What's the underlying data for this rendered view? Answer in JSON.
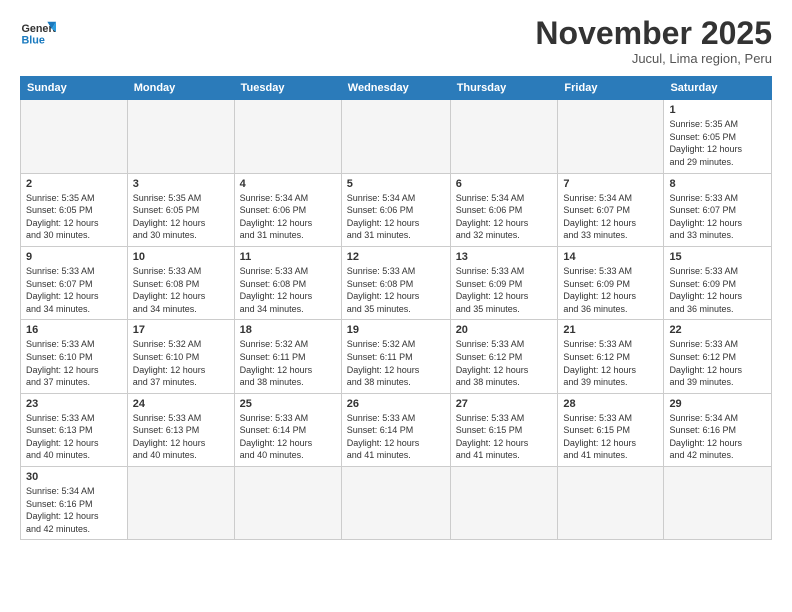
{
  "header": {
    "logo_general": "General",
    "logo_blue": "Blue",
    "month_title": "November 2025",
    "subtitle": "Jucul, Lima region, Peru"
  },
  "days_of_week": [
    "Sunday",
    "Monday",
    "Tuesday",
    "Wednesday",
    "Thursday",
    "Friday",
    "Saturday"
  ],
  "weeks": [
    [
      {
        "day": "",
        "info": ""
      },
      {
        "day": "",
        "info": ""
      },
      {
        "day": "",
        "info": ""
      },
      {
        "day": "",
        "info": ""
      },
      {
        "day": "",
        "info": ""
      },
      {
        "day": "",
        "info": ""
      },
      {
        "day": "1",
        "info": "Sunrise: 5:35 AM\nSunset: 6:05 PM\nDaylight: 12 hours\nand 29 minutes."
      }
    ],
    [
      {
        "day": "2",
        "info": "Sunrise: 5:35 AM\nSunset: 6:05 PM\nDaylight: 12 hours\nand 30 minutes."
      },
      {
        "day": "3",
        "info": "Sunrise: 5:35 AM\nSunset: 6:05 PM\nDaylight: 12 hours\nand 30 minutes."
      },
      {
        "day": "4",
        "info": "Sunrise: 5:34 AM\nSunset: 6:06 PM\nDaylight: 12 hours\nand 31 minutes."
      },
      {
        "day": "5",
        "info": "Sunrise: 5:34 AM\nSunset: 6:06 PM\nDaylight: 12 hours\nand 31 minutes."
      },
      {
        "day": "6",
        "info": "Sunrise: 5:34 AM\nSunset: 6:06 PM\nDaylight: 12 hours\nand 32 minutes."
      },
      {
        "day": "7",
        "info": "Sunrise: 5:34 AM\nSunset: 6:07 PM\nDaylight: 12 hours\nand 33 minutes."
      },
      {
        "day": "8",
        "info": "Sunrise: 5:33 AM\nSunset: 6:07 PM\nDaylight: 12 hours\nand 33 minutes."
      }
    ],
    [
      {
        "day": "9",
        "info": "Sunrise: 5:33 AM\nSunset: 6:07 PM\nDaylight: 12 hours\nand 34 minutes."
      },
      {
        "day": "10",
        "info": "Sunrise: 5:33 AM\nSunset: 6:08 PM\nDaylight: 12 hours\nand 34 minutes."
      },
      {
        "day": "11",
        "info": "Sunrise: 5:33 AM\nSunset: 6:08 PM\nDaylight: 12 hours\nand 34 minutes."
      },
      {
        "day": "12",
        "info": "Sunrise: 5:33 AM\nSunset: 6:08 PM\nDaylight: 12 hours\nand 35 minutes."
      },
      {
        "day": "13",
        "info": "Sunrise: 5:33 AM\nSunset: 6:09 PM\nDaylight: 12 hours\nand 35 minutes."
      },
      {
        "day": "14",
        "info": "Sunrise: 5:33 AM\nSunset: 6:09 PM\nDaylight: 12 hours\nand 36 minutes."
      },
      {
        "day": "15",
        "info": "Sunrise: 5:33 AM\nSunset: 6:09 PM\nDaylight: 12 hours\nand 36 minutes."
      }
    ],
    [
      {
        "day": "16",
        "info": "Sunrise: 5:33 AM\nSunset: 6:10 PM\nDaylight: 12 hours\nand 37 minutes."
      },
      {
        "day": "17",
        "info": "Sunrise: 5:32 AM\nSunset: 6:10 PM\nDaylight: 12 hours\nand 37 minutes."
      },
      {
        "day": "18",
        "info": "Sunrise: 5:32 AM\nSunset: 6:11 PM\nDaylight: 12 hours\nand 38 minutes."
      },
      {
        "day": "19",
        "info": "Sunrise: 5:32 AM\nSunset: 6:11 PM\nDaylight: 12 hours\nand 38 minutes."
      },
      {
        "day": "20",
        "info": "Sunrise: 5:33 AM\nSunset: 6:12 PM\nDaylight: 12 hours\nand 38 minutes."
      },
      {
        "day": "21",
        "info": "Sunrise: 5:33 AM\nSunset: 6:12 PM\nDaylight: 12 hours\nand 39 minutes."
      },
      {
        "day": "22",
        "info": "Sunrise: 5:33 AM\nSunset: 6:12 PM\nDaylight: 12 hours\nand 39 minutes."
      }
    ],
    [
      {
        "day": "23",
        "info": "Sunrise: 5:33 AM\nSunset: 6:13 PM\nDaylight: 12 hours\nand 40 minutes."
      },
      {
        "day": "24",
        "info": "Sunrise: 5:33 AM\nSunset: 6:13 PM\nDaylight: 12 hours\nand 40 minutes."
      },
      {
        "day": "25",
        "info": "Sunrise: 5:33 AM\nSunset: 6:14 PM\nDaylight: 12 hours\nand 40 minutes."
      },
      {
        "day": "26",
        "info": "Sunrise: 5:33 AM\nSunset: 6:14 PM\nDaylight: 12 hours\nand 41 minutes."
      },
      {
        "day": "27",
        "info": "Sunrise: 5:33 AM\nSunset: 6:15 PM\nDaylight: 12 hours\nand 41 minutes."
      },
      {
        "day": "28",
        "info": "Sunrise: 5:33 AM\nSunset: 6:15 PM\nDaylight: 12 hours\nand 41 minutes."
      },
      {
        "day": "29",
        "info": "Sunrise: 5:34 AM\nSunset: 6:16 PM\nDaylight: 12 hours\nand 42 minutes."
      }
    ],
    [
      {
        "day": "30",
        "info": "Sunrise: 5:34 AM\nSunset: 6:16 PM\nDaylight: 12 hours\nand 42 minutes."
      },
      {
        "day": "",
        "info": ""
      },
      {
        "day": "",
        "info": ""
      },
      {
        "day": "",
        "info": ""
      },
      {
        "day": "",
        "info": ""
      },
      {
        "day": "",
        "info": ""
      },
      {
        "day": "",
        "info": ""
      }
    ]
  ]
}
